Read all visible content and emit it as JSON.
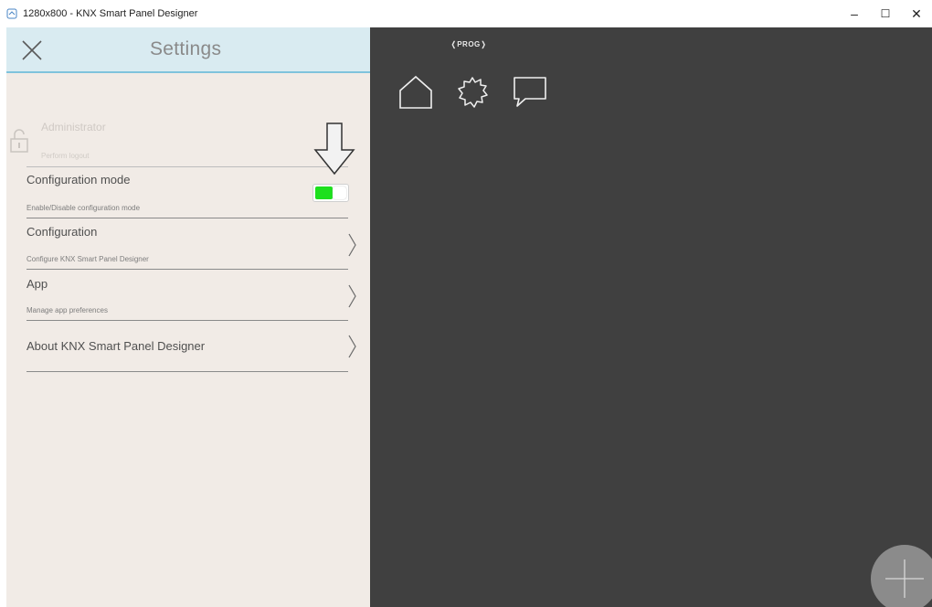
{
  "window": {
    "title": "1280x800 - KNX Smart Panel Designer",
    "controls": {
      "minimize": "–",
      "maximize": "☐",
      "close": "✕"
    }
  },
  "settings": {
    "title": "Settings",
    "admin": {
      "title": "Administrator",
      "subtitle": "Perform logout"
    },
    "items": [
      {
        "title": "Configuration mode",
        "subtitle": "Enable/Disable configuration mode",
        "toggle_on": true
      },
      {
        "title": "Configuration",
        "subtitle": "Configure KNX Smart Panel Designer"
      },
      {
        "title": "App",
        "subtitle": "Manage app preferences"
      },
      {
        "title": "About KNX Smart Panel Designer"
      }
    ]
  },
  "canvas": {
    "prog_label": "PROG",
    "icons": [
      "home-icon",
      "gear-icon",
      "chat-icon"
    ],
    "fab_icon": "plus-icon"
  },
  "colors": {
    "header_bg": "#d9ebf1",
    "header_line": "#7fc3dc",
    "panel_bg": "#f1ebe6",
    "canvas_bg": "#404040",
    "toggle_on": "#1de01d"
  }
}
